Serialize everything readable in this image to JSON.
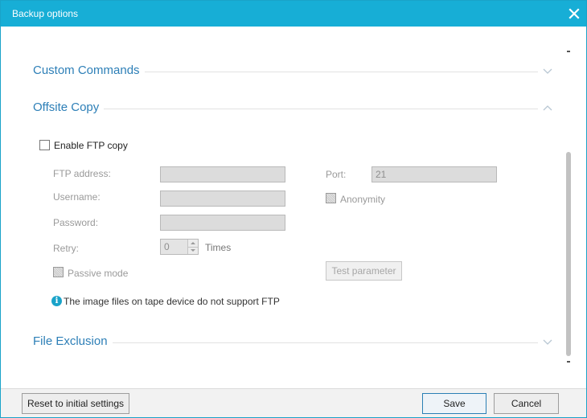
{
  "window": {
    "title": "Backup options"
  },
  "sections": {
    "custom_commands": "Custom Commands",
    "offsite_copy": "Offsite Copy",
    "file_exclusion": "File Exclusion"
  },
  "ftp": {
    "enable_label": "Enable FTP copy",
    "address_label": "FTP address:",
    "address_value": "",
    "username_label": "Username:",
    "username_value": "",
    "password_label": "Password:",
    "password_value": "",
    "retry_label": "Retry:",
    "retry_value": "0",
    "retry_unit": "Times",
    "port_label": "Port:",
    "port_value": "21",
    "anonymity_label": "Anonymity",
    "passive_label": "Passive mode",
    "test_button": "Test parameter",
    "info_text": "The image files on tape device do not support FTP"
  },
  "footer": {
    "reset_label": "Reset to initial settings",
    "save_label": "Save",
    "cancel_label": "Cancel"
  },
  "colors": {
    "titlebar": "#17aed6",
    "section_title": "#2d7fb7",
    "info_icon": "#1aa3c9"
  }
}
